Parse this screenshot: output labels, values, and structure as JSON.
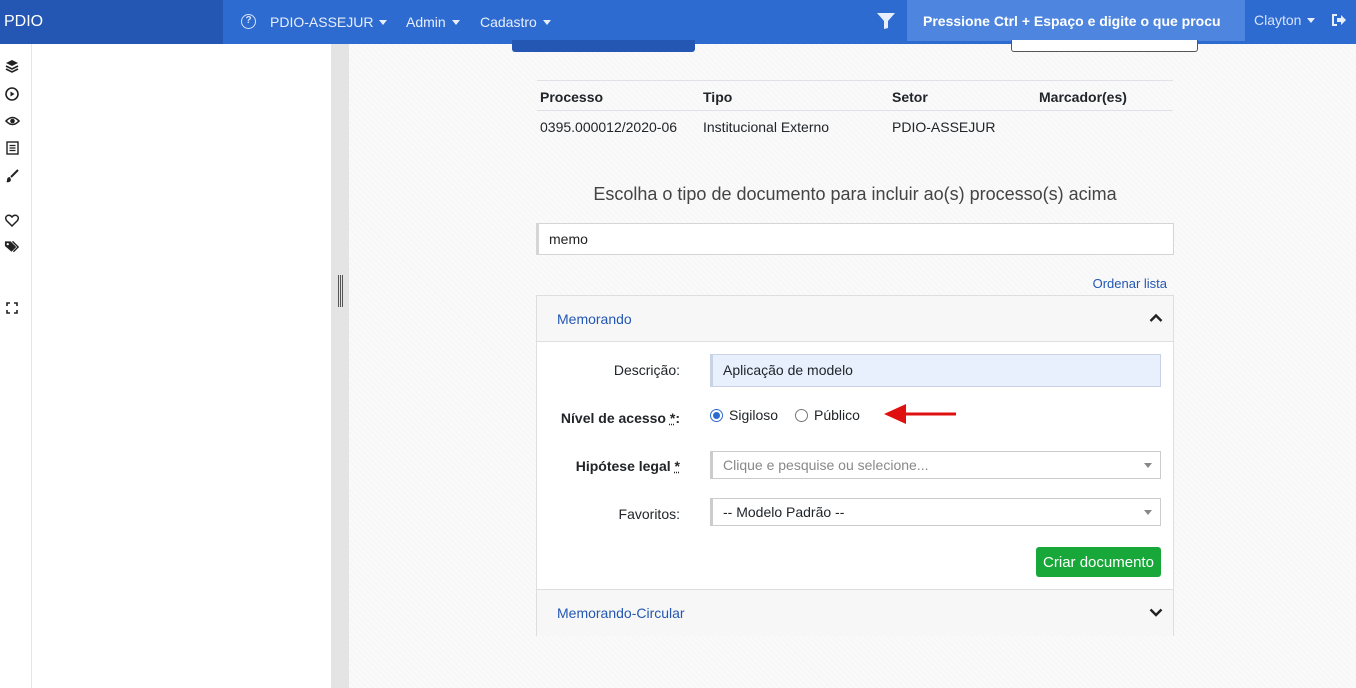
{
  "navbar": {
    "brand": "PDIO",
    "unit_menu": "PDIO-ASSEJUR",
    "admin_menu": "Admin",
    "cadastro_menu": "Cadastro",
    "search_placeholder": "Pressione Ctrl + Espaço e digite o que procu",
    "user_menu": "Clayton",
    "icons": [
      "help-icon",
      "filter-icon",
      "logout-icon"
    ],
    "colors": {
      "bar": "#2d6bd1",
      "brand_bg": "#2357b3",
      "search_bg": "#4e86df"
    }
  },
  "rail_icons": [
    "layers-icon",
    "play-circle-icon",
    "eye-icon",
    "list-icon",
    "brush-icon",
    "heart-icon",
    "tags-icon",
    "expand-icon"
  ],
  "process_table": {
    "headers": [
      "Processo",
      "Tipo",
      "Setor",
      "Marcador(es)"
    ],
    "rows": [
      [
        "0395.000012/2020-06",
        "Institucional Externo",
        "PDIO-ASSEJUR",
        ""
      ]
    ]
  },
  "choose_title": "Escolha o tipo de documento para incluir ao(s) processo(s) acima",
  "filter_value": "memo",
  "order_link": "Ordenar lista",
  "accordion": {
    "memorando": {
      "title": "Memorando",
      "descricao_label": "Descrição:",
      "descricao_value": "Aplicação de modelo",
      "nivel_label": "Nível de acesso",
      "nivel_req": "*",
      "nivel_suffix": ":",
      "radio_sigiloso": "Sigiloso",
      "radio_publico": "Público",
      "selected_nivel": "Sigiloso",
      "hipotese_label": "Hipótese legal",
      "hipotese_req": "*",
      "hipotese_placeholder": "Clique e pesquise ou selecione...",
      "favoritos_label": "Favoritos:",
      "favoritos_value": "-- Modelo Padrão --",
      "create_button": "Criar documento"
    },
    "circular": {
      "title": "Memorando-Circular"
    }
  },
  "colors": {
    "accent_link": "#2357b3",
    "create_button": "#18a83a",
    "annotation_arrow": "#e01010"
  }
}
